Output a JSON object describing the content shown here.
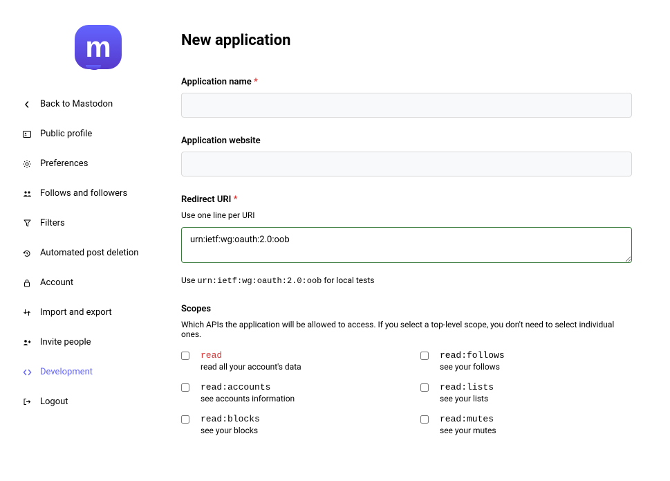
{
  "sidebar": {
    "items": [
      {
        "label": "Back to Mastodon"
      },
      {
        "label": "Public profile"
      },
      {
        "label": "Preferences"
      },
      {
        "label": "Follows and followers"
      },
      {
        "label": "Filters"
      },
      {
        "label": "Automated post deletion"
      },
      {
        "label": "Account"
      },
      {
        "label": "Import and export"
      },
      {
        "label": "Invite people"
      },
      {
        "label": "Development"
      },
      {
        "label": "Logout"
      }
    ]
  },
  "header": {
    "title": "New application"
  },
  "form": {
    "app_name": {
      "label": "Application name",
      "required": "*",
      "value": ""
    },
    "app_website": {
      "label": "Application website",
      "value": ""
    },
    "redirect_uri": {
      "label": "Redirect URI",
      "required": "*",
      "hint": "Use one line per URI",
      "value": "urn:ietf:wg:oauth:2.0:oob",
      "posthint_prefix": "Use  ",
      "posthint_code": "urn:ietf:wg:oauth:2.0:oob",
      "posthint_suffix": "  for local tests"
    },
    "scopes": {
      "label": "Scopes",
      "hint": "Which APIs the application will be allowed to access. If you select a top-level scope, you don't need to select individual ones.",
      "left": [
        {
          "name": "read",
          "desc": "read all your account's data",
          "top": true
        },
        {
          "name": "read:accounts",
          "desc": "see accounts information"
        },
        {
          "name": "read:blocks",
          "desc": "see your blocks"
        }
      ],
      "right": [
        {
          "name": "read:follows",
          "desc": "see your follows"
        },
        {
          "name": "read:lists",
          "desc": "see your lists"
        },
        {
          "name": "read:mutes",
          "desc": "see your mutes"
        }
      ]
    }
  }
}
